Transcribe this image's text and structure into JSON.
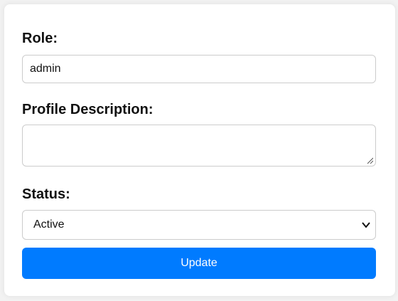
{
  "form": {
    "role_label": "Role:",
    "role_value": "admin",
    "profile_description_label": "Profile Description:",
    "profile_description_value": "",
    "status_label": "Status:",
    "status_selected": "Active",
    "update_label": "Update"
  },
  "icons": {
    "textarea_resize": "resize-handle-icon",
    "select_dropdown": "chevron-down-icon"
  },
  "colors": {
    "button_bg": "#007bff",
    "button_text": "#ffffff",
    "border": "#cccccc",
    "page_bg": "#f2f2f2",
    "card_bg": "#ffffff"
  }
}
